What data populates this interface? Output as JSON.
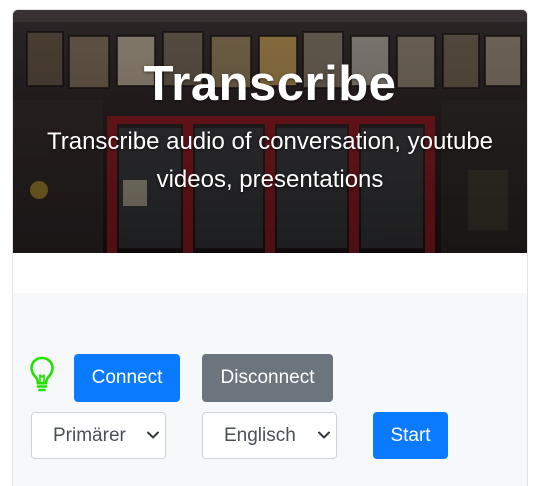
{
  "hero": {
    "title": "Transcribe",
    "subtitle": "Transcribe audio of conversation, youtube videos, presentations"
  },
  "controls": {
    "status_icon": "lightbulb-icon",
    "status_color": "#22e000",
    "connect_label": "Connect",
    "disconnect_label": "Disconnect",
    "source_select": {
      "selected": "Primärer"
    },
    "language_select": {
      "selected": "Englisch"
    },
    "start_label": "Start"
  },
  "colors": {
    "primary": "#0a7bff",
    "secondary": "#6c757d",
    "panel_background": "#f7f8fa"
  }
}
